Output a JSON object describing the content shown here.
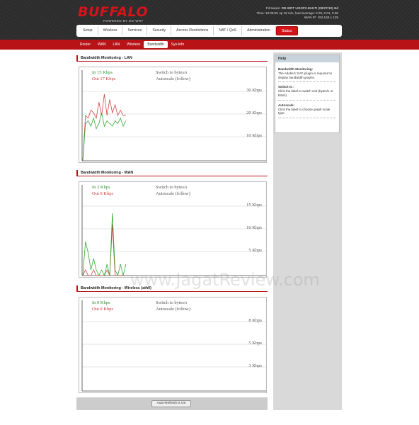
{
  "header": {
    "logo": "BUFFALO",
    "logo_sub": "POWERED BY DD-WRT",
    "firmware_label": "Firmware:",
    "firmware_value": "DD-WRT v24SP2-MULTI (08/27/10) std",
    "time_line": "Time: 10:28:55 up 19 min, load average: 0.00, 0.01, 0.00",
    "wan_label": "WAN IP:",
    "wan_value": "192.168.1.139"
  },
  "main_nav": [
    "Setup",
    "Wireless",
    "Services",
    "Security",
    "Access Restrictions",
    "NAT / QoS",
    "Administration",
    "Status"
  ],
  "sub_nav": [
    "Router",
    "WAN",
    "LAN",
    "Wireless",
    "Bandwidth",
    "Sys-Info"
  ],
  "sections": [
    {
      "title": "Bandwidth Monitoring - LAN",
      "in": "In  15 Kbps",
      "out": "Out  17 Kbps",
      "switch": "Switch to bytes/s",
      "autoscale": "Autoscale (follow)",
      "scales": [
        "30 Kbps",
        "20 Kbps",
        "10 Kbps"
      ]
    },
    {
      "title": "Bandwidth Monitoring - WAN",
      "in": "In  2 Kbps",
      "out": "Out  0 Kbps",
      "switch": "Switch to bytes/s",
      "autoscale": "Autoscale (follow)",
      "scales": [
        "15 Kbps",
        "10 Kbps",
        "5 Kbps"
      ]
    },
    {
      "title": "Bandwidth Monitoring - Wireless (ath0)",
      "in": "In  0 Kbps",
      "out": "Out  0 Kbps",
      "switch": "Switch to bytes/s",
      "autoscale": "Autoscale (follow)",
      "scales": [
        "8 Kbps",
        "5 Kbps",
        "3 Kbps"
      ]
    }
  ],
  "graphs": {
    "lan_in": [
      0,
      14,
      15,
      13,
      16,
      12,
      14,
      18,
      13,
      15,
      14,
      13,
      15,
      14,
      16,
      13,
      15
    ],
    "lan_out": [
      0,
      17,
      16,
      19,
      18,
      16,
      22,
      17,
      25,
      17,
      23,
      18,
      21,
      17,
      19,
      17,
      17
    ],
    "wan_in": [
      0,
      6,
      4,
      1,
      3,
      1,
      0,
      1,
      0,
      2,
      0,
      11,
      1,
      0,
      2,
      0,
      2
    ],
    "wan_out": [
      0,
      1,
      0,
      0,
      1,
      0,
      0,
      0,
      0,
      1,
      0,
      9,
      0,
      0,
      0,
      0,
      0
    ],
    "colors": {
      "in": "#33aa33",
      "out": "#cc4444"
    }
  },
  "refresh_button": "Auto-Refresh is On",
  "help": {
    "title": "Help",
    "items": [
      {
        "term": "Bandwidth Monitoring:",
        "desc": "The Adobe's SVG plugin is required to display bandwidth graphs."
      },
      {
        "term": "Switch to :",
        "desc": "Click the label to switch unit (bytes/s or bits/s)."
      },
      {
        "term": "Autoscale:",
        "desc": "Click the label to choose graph scale type."
      }
    ]
  },
  "watermark": "www.JagatReview.com"
}
